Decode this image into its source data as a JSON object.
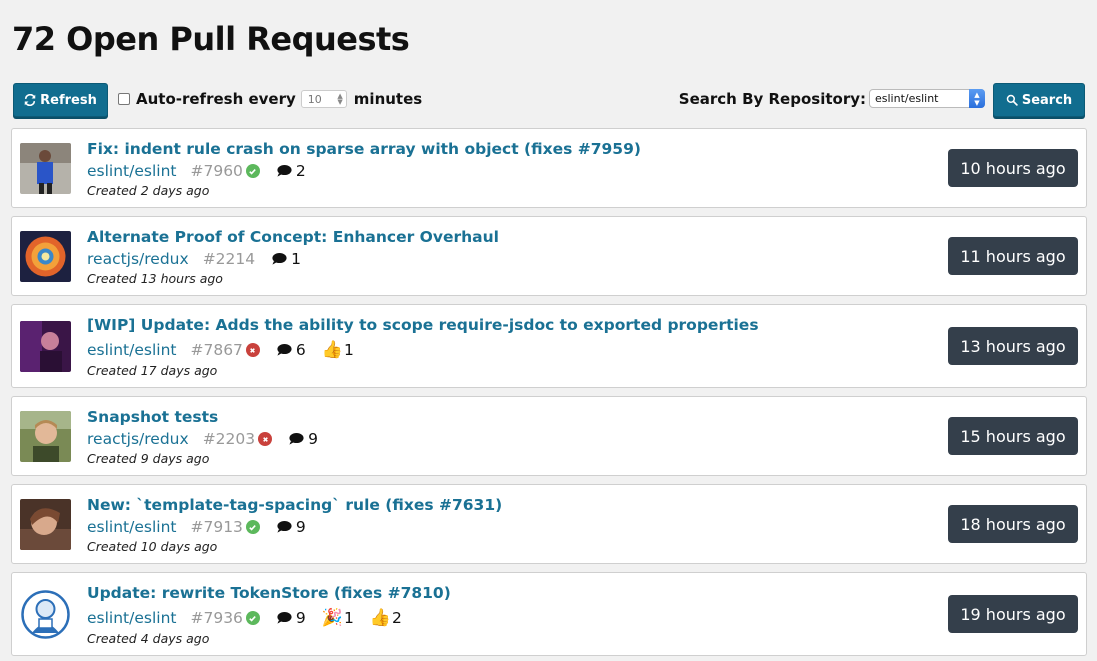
{
  "page_title": "72 Open Pull Requests",
  "toolbar": {
    "refresh_label": "Refresh",
    "auto_refresh_label": "Auto-refresh every",
    "interval_value": "10",
    "interval_unit": "minutes",
    "search_label": "Search By Repository:",
    "repo_value": "eslint/eslint",
    "search_button": "Search"
  },
  "colors": {
    "accent": "#116d8f",
    "link": "#1a7194",
    "time_badge": "#343f4b",
    "success": "#5cb85c",
    "failure": "#c9413c"
  },
  "pull_requests": [
    {
      "title": "Fix: indent rule crash on sparse array with object (fixes #7959)",
      "repo": "eslint/eslint",
      "number": "#7960",
      "status": "success",
      "comments": "2",
      "created": "Created 2 days ago",
      "updated": "10 hours ago"
    },
    {
      "title": "Alternate Proof of Concept: Enhancer Overhaul",
      "repo": "reactjs/redux",
      "number": "#2214",
      "status": "none",
      "comments": "1",
      "created": "Created 13 hours ago",
      "updated": "11 hours ago"
    },
    {
      "title": "[WIP] Update: Adds the ability to scope require-jsdoc to exported properties",
      "repo": "eslint/eslint",
      "number": "#7867",
      "status": "failure",
      "comments": "6",
      "thumbs_up": "1",
      "created": "Created 17 days ago",
      "updated": "13 hours ago"
    },
    {
      "title": "Snapshot tests",
      "repo": "reactjs/redux",
      "number": "#2203",
      "status": "failure",
      "comments": "9",
      "created": "Created 9 days ago",
      "updated": "15 hours ago"
    },
    {
      "title": "New: `template-tag-spacing` rule (fixes #7631)",
      "repo": "eslint/eslint",
      "number": "#7913",
      "status": "success",
      "comments": "9",
      "created": "Created 10 days ago",
      "updated": "18 hours ago"
    },
    {
      "title": "Update: rewrite TokenStore (fixes #7810)",
      "repo": "eslint/eslint",
      "number": "#7936",
      "status": "success",
      "comments": "9",
      "tada": "1",
      "thumbs_up": "2",
      "created": "Created 4 days ago",
      "updated": "19 hours ago"
    }
  ]
}
